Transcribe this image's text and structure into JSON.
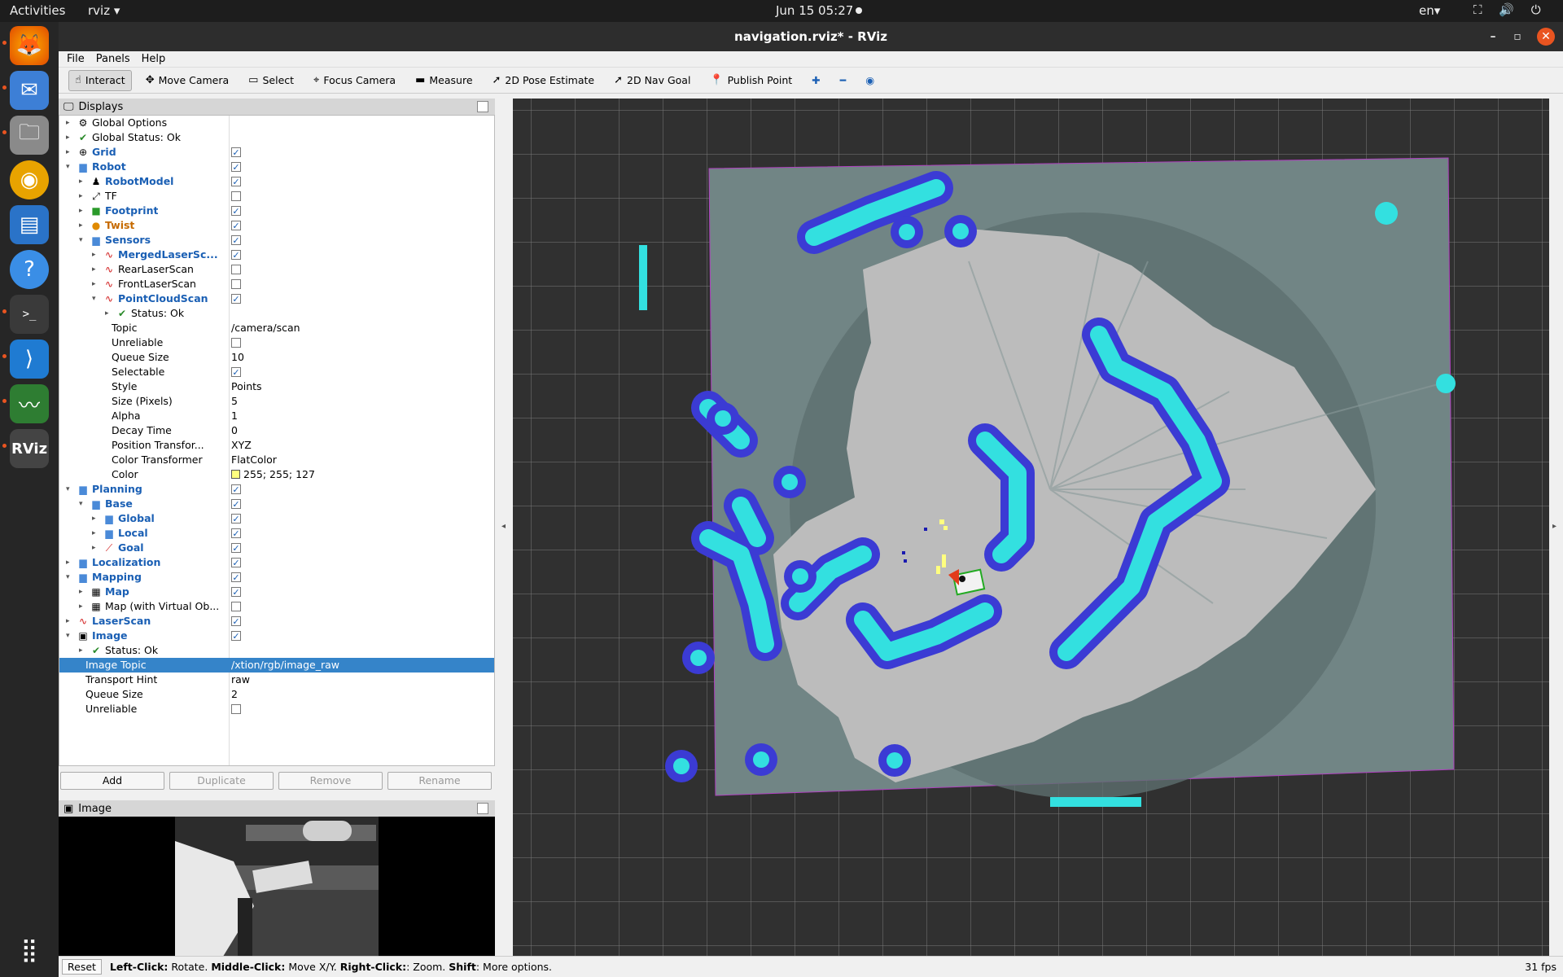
{
  "topbar": {
    "activities": "Activities",
    "app": "rviz ▾",
    "clock": "Jun 15  05:27",
    "lang": "en▾",
    "sys": "⛶ 🔊 ⏻ ▾"
  },
  "dock": {
    "icons": [
      "firefox-icon",
      "thunderbird-icon",
      "files-icon",
      "rhythmbox-icon",
      "writer-icon",
      "help-icon",
      "terminal-icon",
      "vscode-icon",
      "system-monitor-icon",
      "rviz-icon",
      "app-grid-icon"
    ]
  },
  "window": {
    "title": "navigation.rviz* - RViz",
    "min": "–",
    "max": "▫",
    "close": "✕"
  },
  "menu": [
    "File",
    "Panels",
    "Help"
  ],
  "toolbar": [
    {
      "label": "Interact",
      "icon": "☝",
      "active": true
    },
    {
      "label": "Move Camera",
      "icon": "✥"
    },
    {
      "label": "Select",
      "icon": "▭"
    },
    {
      "label": "Focus Camera",
      "icon": "⌖"
    },
    {
      "label": "Measure",
      "icon": "▬"
    },
    {
      "label": "2D Pose Estimate",
      "icon": "➚"
    },
    {
      "label": "2D Nav Goal",
      "icon": "➚"
    },
    {
      "label": "Publish Point",
      "icon": "📍"
    }
  ],
  "displays_panel": {
    "title": "Displays"
  },
  "tree": [
    {
      "indent": 0,
      "arrow": "▸",
      "icon": "⚙",
      "label": "Global Options",
      "style": ""
    },
    {
      "indent": 0,
      "arrow": "▸",
      "icon": "✔",
      "label": "Global Status: Ok",
      "style": ""
    },
    {
      "indent": 0,
      "arrow": "▸",
      "icon": "⊕",
      "label": "Grid",
      "style": "blue",
      "check": true
    },
    {
      "indent": 0,
      "arrow": "▾",
      "icon": "▆",
      "label": "Robot",
      "style": "blue",
      "check": true
    },
    {
      "indent": 1,
      "arrow": "▸",
      "icon": "♟",
      "label": "RobotModel",
      "style": "blue",
      "check": true
    },
    {
      "indent": 1,
      "arrow": "▸",
      "icon": "⤢",
      "label": "TF",
      "style": "",
      "check": false
    },
    {
      "indent": 1,
      "arrow": "▸",
      "icon": "■",
      "label": "Footprint",
      "style": "blue",
      "check": true
    },
    {
      "indent": 1,
      "arrow": "▸",
      "icon": "●",
      "label": "Twist",
      "style": "orange",
      "check": true
    },
    {
      "indent": 1,
      "arrow": "▾",
      "icon": "▆",
      "label": "Sensors",
      "style": "blue",
      "check": true
    },
    {
      "indent": 2,
      "arrow": "▸",
      "icon": "∿",
      "label": "MergedLaserSc...",
      "style": "blue",
      "check": true
    },
    {
      "indent": 2,
      "arrow": "▸",
      "icon": "∿",
      "label": "RearLaserScan",
      "style": "",
      "check": false
    },
    {
      "indent": 2,
      "arrow": "▸",
      "icon": "∿",
      "label": "FrontLaserScan",
      "style": "",
      "check": false
    },
    {
      "indent": 2,
      "arrow": "▾",
      "icon": "∿",
      "label": "PointCloudScan",
      "style": "blue",
      "check": true
    },
    {
      "indent": 3,
      "arrow": "▸",
      "icon": "✔",
      "label": "Status: Ok",
      "style": ""
    },
    {
      "indent": 3,
      "arrow": "",
      "icon": "",
      "label": "Topic",
      "style": "",
      "value": "/camera/scan"
    },
    {
      "indent": 3,
      "arrow": "",
      "icon": "",
      "label": "Unreliable",
      "style": "",
      "check": false
    },
    {
      "indent": 3,
      "arrow": "",
      "icon": "",
      "label": "Queue Size",
      "style": "",
      "value": "10"
    },
    {
      "indent": 3,
      "arrow": "",
      "icon": "",
      "label": "Selectable",
      "style": "",
      "check": true
    },
    {
      "indent": 3,
      "arrow": "",
      "icon": "",
      "label": "Style",
      "style": "",
      "value": "Points"
    },
    {
      "indent": 3,
      "arrow": "",
      "icon": "",
      "label": "Size (Pixels)",
      "style": "",
      "value": "5"
    },
    {
      "indent": 3,
      "arrow": "",
      "icon": "",
      "label": "Alpha",
      "style": "",
      "value": "1"
    },
    {
      "indent": 3,
      "arrow": "",
      "icon": "",
      "label": "Decay Time",
      "style": "",
      "value": "0"
    },
    {
      "indent": 3,
      "arrow": "",
      "icon": "",
      "label": "Position Transfor...",
      "style": "",
      "value": "XYZ"
    },
    {
      "indent": 3,
      "arrow": "",
      "icon": "",
      "label": "Color Transformer",
      "style": "",
      "value": "FlatColor"
    },
    {
      "indent": 3,
      "arrow": "",
      "icon": "",
      "label": "Color",
      "style": "",
      "value": "255; 255; 127",
      "swatch": "#ffff7f"
    },
    {
      "indent": 0,
      "arrow": "▾",
      "icon": "▆",
      "label": "Planning",
      "style": "blue",
      "check": true
    },
    {
      "indent": 1,
      "arrow": "▾",
      "icon": "▆",
      "label": "Base",
      "style": "blue",
      "check": true
    },
    {
      "indent": 2,
      "arrow": "▸",
      "icon": "▆",
      "label": "Global",
      "style": "blue",
      "check": true
    },
    {
      "indent": 2,
      "arrow": "▸",
      "icon": "▆",
      "label": "Local",
      "style": "blue",
      "check": true
    },
    {
      "indent": 2,
      "arrow": "▸",
      "icon": "⟋",
      "label": "Goal",
      "style": "blue",
      "check": true
    },
    {
      "indent": 0,
      "arrow": "▸",
      "icon": "▆",
      "label": "Localization",
      "style": "blue",
      "check": true
    },
    {
      "indent": 0,
      "arrow": "▾",
      "icon": "▆",
      "label": "Mapping",
      "style": "blue",
      "check": true
    },
    {
      "indent": 1,
      "arrow": "▸",
      "icon": "▦",
      "label": "Map",
      "style": "blue",
      "check": true
    },
    {
      "indent": 1,
      "arrow": "▸",
      "icon": "▦",
      "label": "Map (with Virtual Ob...",
      "style": "",
      "check": false
    },
    {
      "indent": 0,
      "arrow": "▸",
      "icon": "∿",
      "label": "LaserScan",
      "style": "blue",
      "check": true
    },
    {
      "indent": 0,
      "arrow": "▾",
      "icon": "▣",
      "label": "Image",
      "style": "blue",
      "check": true
    },
    {
      "indent": 1,
      "arrow": "▸",
      "icon": "✔",
      "label": "Status: Ok",
      "style": ""
    },
    {
      "indent": 1,
      "arrow": "",
      "icon": "",
      "label": "Image Topic",
      "style": "",
      "value": "/xtion/rgb/image_raw",
      "selected": true
    },
    {
      "indent": 1,
      "arrow": "",
      "icon": "",
      "label": "Transport Hint",
      "style": "",
      "value": "raw"
    },
    {
      "indent": 1,
      "arrow": "",
      "icon": "",
      "label": "Queue Size",
      "style": "",
      "value": "2"
    },
    {
      "indent": 1,
      "arrow": "",
      "icon": "",
      "label": "Unreliable",
      "style": "",
      "check": false
    }
  ],
  "buttons": {
    "add": "Add",
    "duplicate": "Duplicate",
    "remove": "Remove",
    "rename": "Rename"
  },
  "image_panel": {
    "title": "Image"
  },
  "status": {
    "reset": "Reset",
    "lc": "Left-Click:",
    "lc_t": "Rotate.",
    "mc": "Middle-Click:",
    "mc_t": "Move X/Y.",
    "rc": "Right-Click:",
    "rc_t": ": Zoom.",
    "sh": "Shift",
    "sh_t": ": More options.",
    "fps": "31 fps"
  },
  "colors": {
    "accent": "#3584c9",
    "costmap_cyan": "#33e0e0",
    "costmap_blue": "#3b3bd4",
    "map_free": "#b8b8b8",
    "map_unknown": "#6f8585",
    "grid_bg": "#303030"
  }
}
